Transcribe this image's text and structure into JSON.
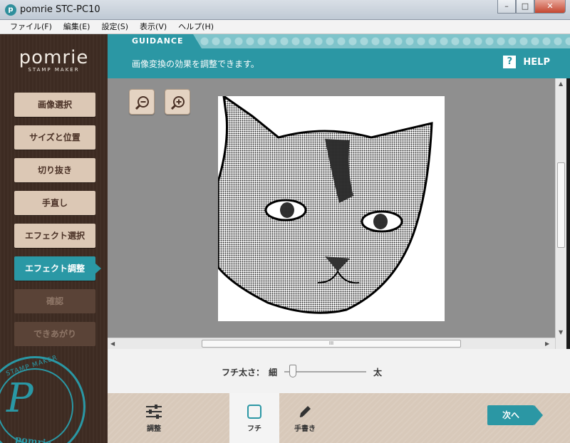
{
  "window": {
    "title": "pomrie STC-PC10",
    "icon": "app-logo-icon",
    "minimize": "–",
    "maximize": "□",
    "close": "✕"
  },
  "menu": [
    {
      "label": "ファイル(F)"
    },
    {
      "label": "編集(E)"
    },
    {
      "label": "設定(S)"
    },
    {
      "label": "表示(V)"
    },
    {
      "label": "ヘルプ(H)"
    }
  ],
  "logo": {
    "name": "pomrie",
    "sub": "STAMP MAKER"
  },
  "seal": {
    "top": "STAMP MAKER",
    "letter": "P",
    "bottom": "pomrie"
  },
  "nav": [
    {
      "label": "画像選択",
      "state": "normal"
    },
    {
      "label": "サイズと位置",
      "state": "normal"
    },
    {
      "label": "切り抜き",
      "state": "normal"
    },
    {
      "label": "手直し",
      "state": "normal"
    },
    {
      "label": "エフェクト選択",
      "state": "normal"
    },
    {
      "label": "エフェクト調整",
      "state": "active"
    },
    {
      "label": "確認",
      "state": "disabled"
    },
    {
      "label": "できあがり",
      "state": "disabled"
    }
  ],
  "guidance": {
    "tab": "GUIDANCE",
    "text": "画像変換の効果を調整できます。",
    "help": "HELP",
    "help_icon": "?"
  },
  "hscroll_grip": "III",
  "border_width": {
    "label": "フチ太さ：",
    "thin": "細",
    "thick": "太",
    "level": 0.1
  },
  "tools": [
    {
      "label": "調整",
      "icon": "sliders-icon"
    },
    {
      "label": "フチ",
      "icon": "square-outline-icon",
      "active": true
    },
    {
      "label": "手書き",
      "icon": "pencil-icon"
    }
  ],
  "next_button": "次へ",
  "colors": {
    "accent": "#2b97a4",
    "sidebar": "#3d2b22",
    "nav_button": "#dcc8b5"
  }
}
